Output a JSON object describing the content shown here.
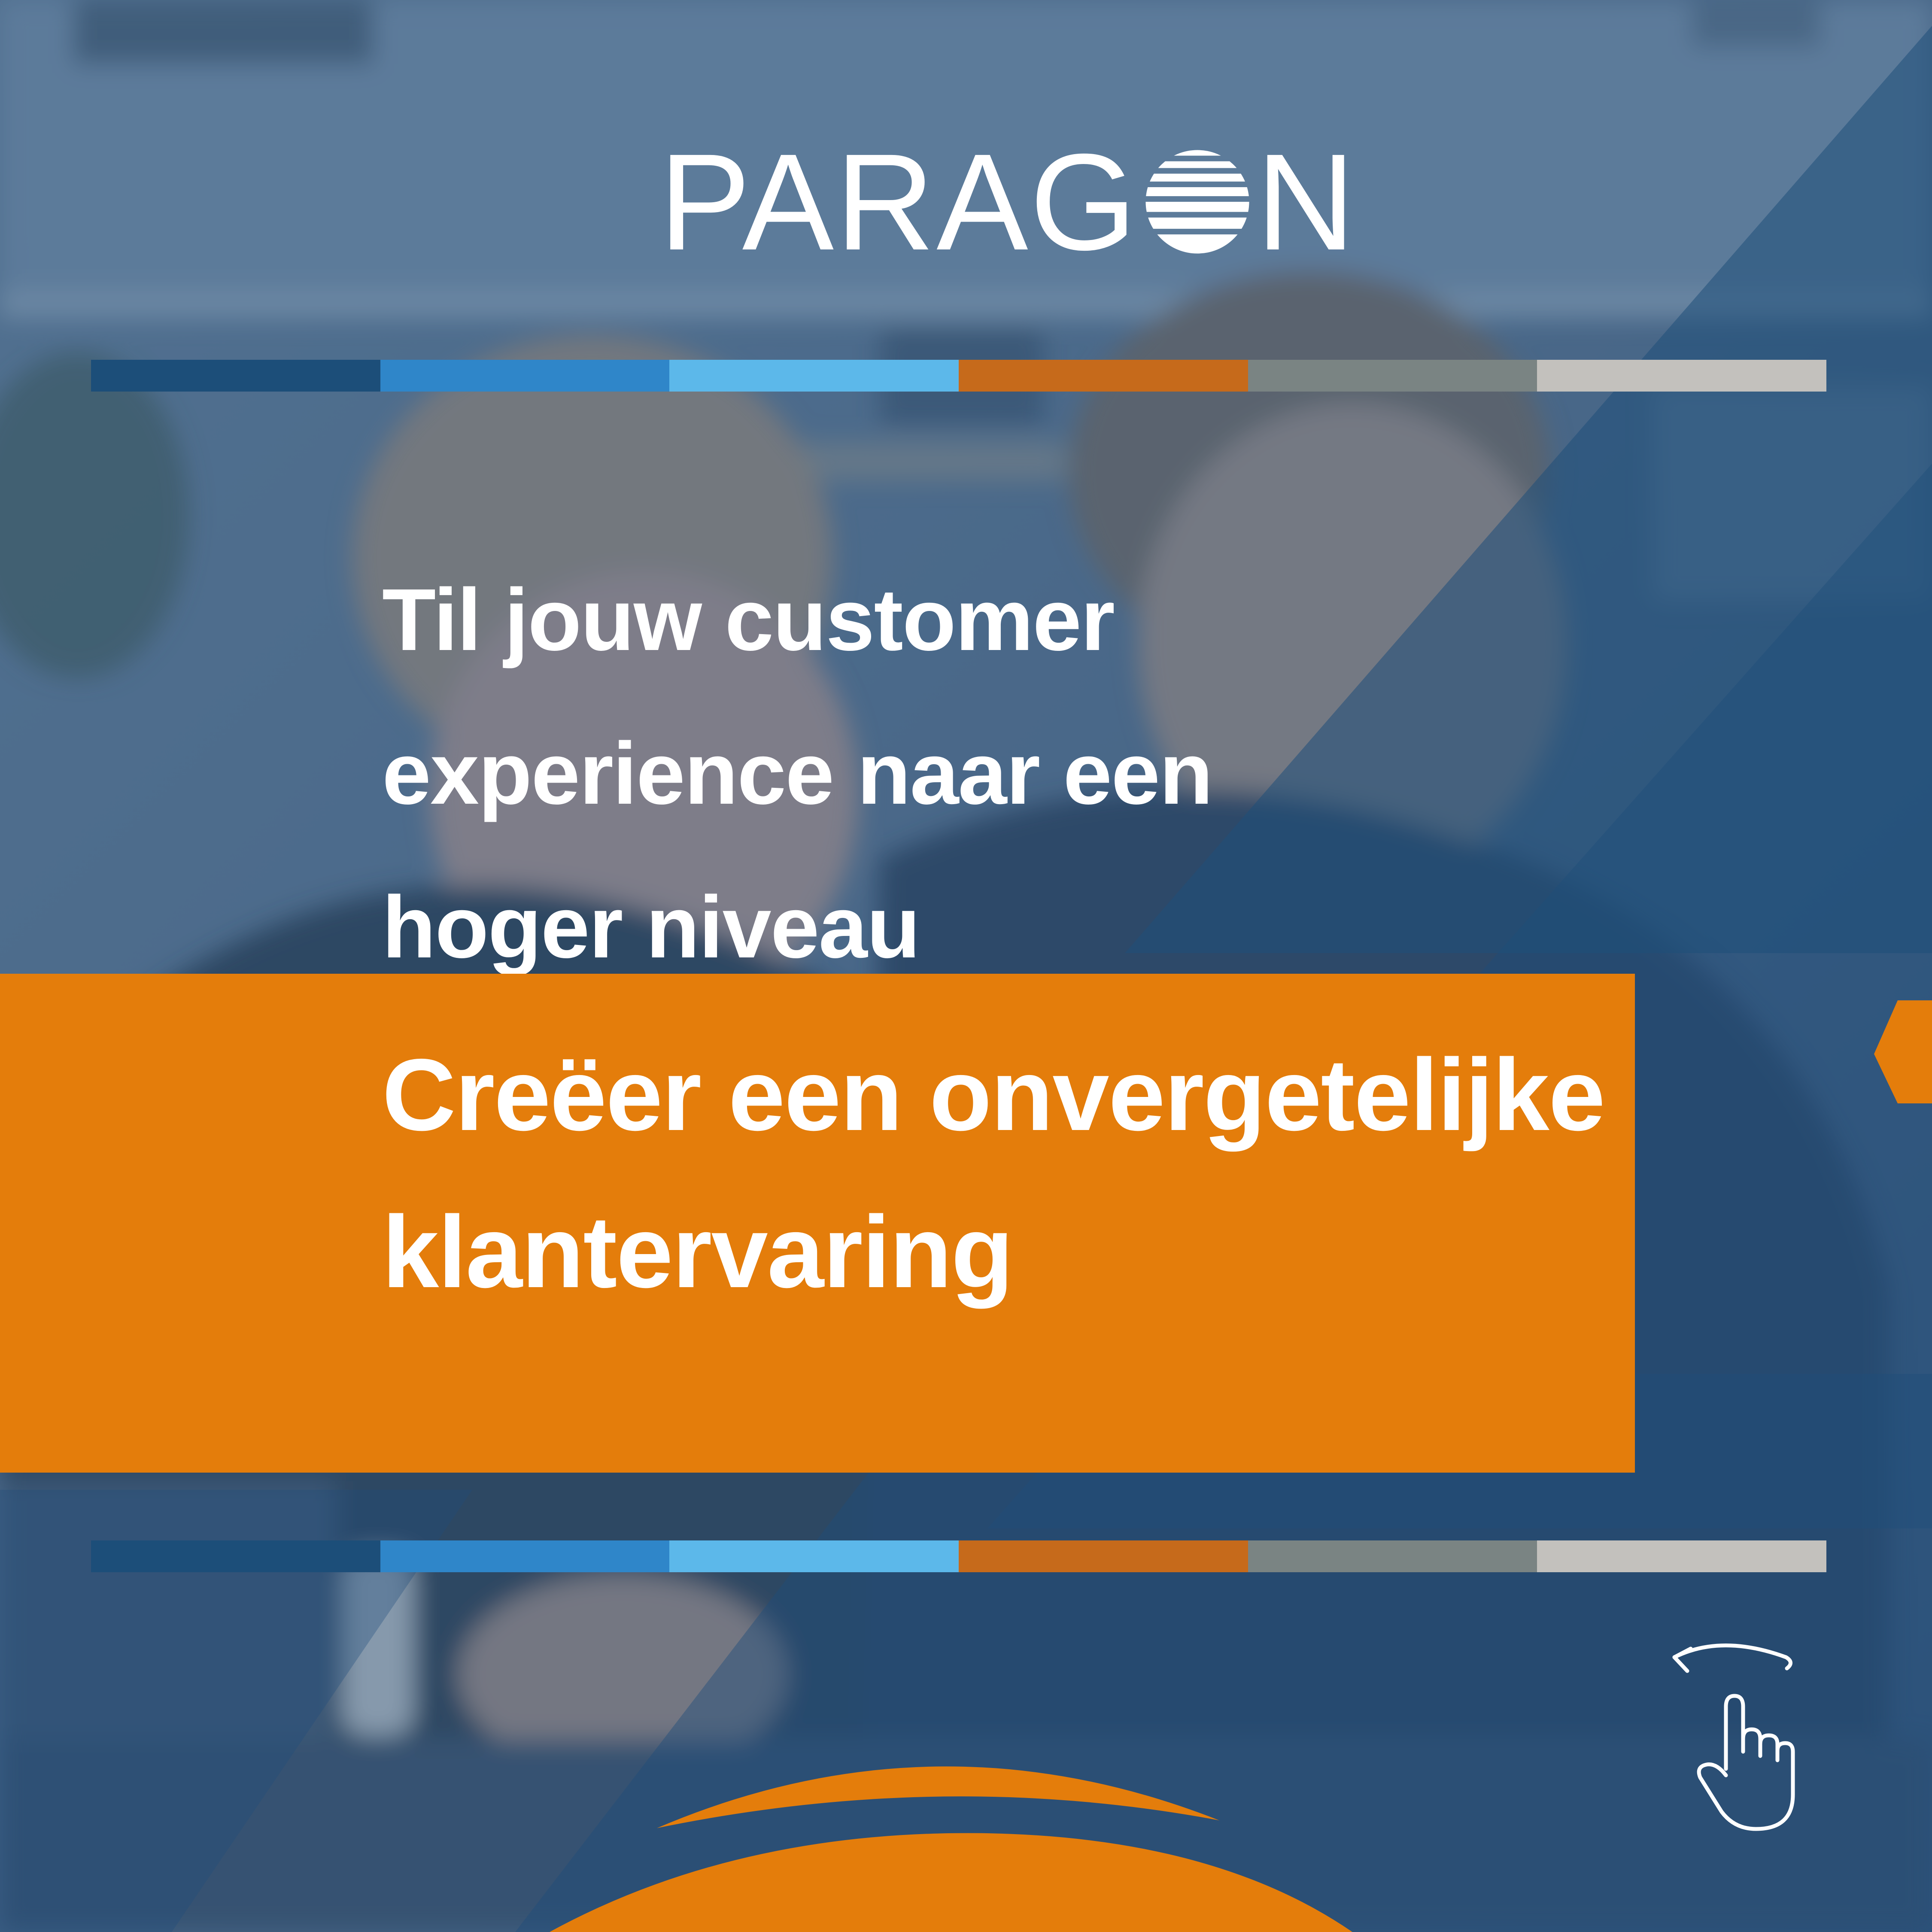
{
  "brand": {
    "name_before": "PARAG",
    "name_after": "N",
    "logo_icon": "striped-globe-icon"
  },
  "headline": "Til jouw customer experience naar een hoger niveau",
  "banner": {
    "text": "Creëer een onvergetelijke klantervaring",
    "color": "#e47d0b"
  },
  "stripe_colors": [
    "#1c4e79",
    "#2f86c9",
    "#5cb8ea",
    "#c66a1b",
    "#7a8483",
    "#c3c1bd"
  ],
  "swipe_icon": "swipe-hand-icon",
  "palette": {
    "overlay_blue": "#2d5a87",
    "accent_orange": "#e47d0b",
    "text": "#ffffff"
  }
}
